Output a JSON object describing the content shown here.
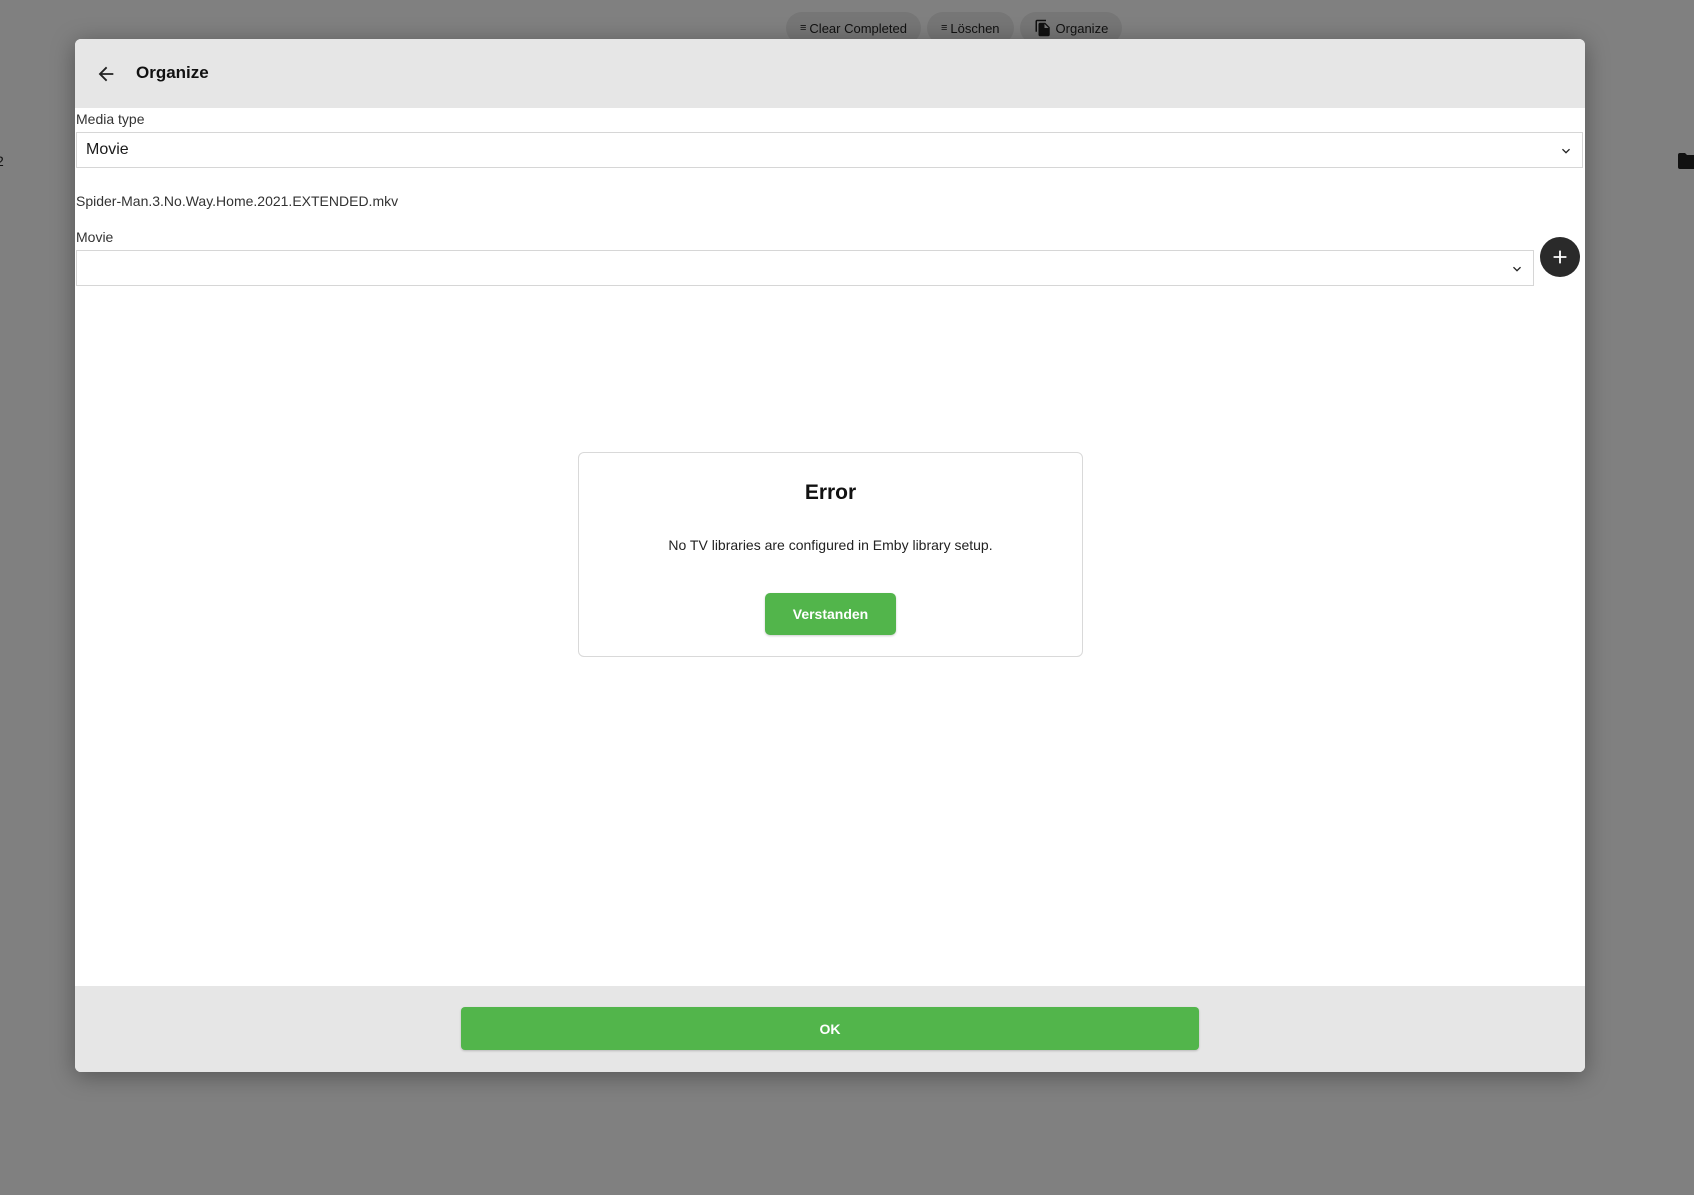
{
  "background": {
    "toolbar": {
      "clear_completed_label": "Clear Completed",
      "delete_label": "Löschen",
      "organize_label": "Organize"
    },
    "left_partial_text": "2"
  },
  "dialog": {
    "title": "Organize",
    "media_type": {
      "label": "Media type",
      "selected": "Movie"
    },
    "filename": "Spider-Man.3.No.Way.Home.2021.EXTENDED.mkv",
    "movie": {
      "label": "Movie",
      "selected": ""
    },
    "ok_label": "OK"
  },
  "error": {
    "title": "Error",
    "message": "No TV libraries are configured in Emby library setup.",
    "confirm_label": "Verstanden"
  },
  "colors": {
    "accent_green": "#52b54b",
    "overlay": "#808080",
    "header_bg": "#e6e6e6"
  }
}
